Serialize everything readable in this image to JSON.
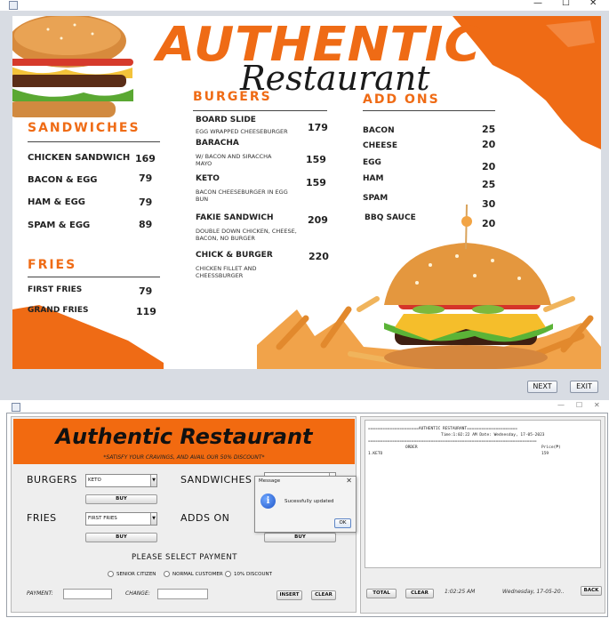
{
  "menu_window": {
    "controls": {
      "minimize": "—",
      "maximize": "☐",
      "close": "✕"
    },
    "header": {
      "title": "AUTHENTIC",
      "subtitle": "Restaurant"
    },
    "sandwiches": {
      "title": "SANDWICHES",
      "items": [
        {
          "name": "CHICKEN SANDWICH",
          "price": "169"
        },
        {
          "name": "BACON & EGG",
          "price": "79"
        },
        {
          "name": "HAM & EGG",
          "price": "79"
        },
        {
          "name": "SPAM & EGG",
          "price": "89"
        }
      ]
    },
    "fries": {
      "title": "FRIES",
      "items": [
        {
          "name": "FIRST FRIES",
          "price": "79"
        },
        {
          "name": "GRAND FRIES",
          "price": "119"
        }
      ]
    },
    "burgers": {
      "title": "BURGERS",
      "items": [
        {
          "name": "BOARD SLIDE",
          "desc": "EGG WRAPPED CHEESEBURGER",
          "price": "179"
        },
        {
          "name": "BARACHA",
          "desc": "W/ BACON AND SIRACCHA MAYO",
          "price": "159"
        },
        {
          "name": "KETO",
          "desc": "BACON CHEESEBURGER IN EGG BUN",
          "price": "159"
        },
        {
          "name": "FAKIE SANDWICH",
          "desc": "DOUBLE DOWN CHICKEN, CHEESE, BACON, NO BURGER",
          "price": "209"
        },
        {
          "name": "CHICK & BURGER",
          "desc": "CHICKEN FILLET AND CHEESSBURGER",
          "price": "220"
        }
      ]
    },
    "addons": {
      "title": "ADD ONS",
      "items": [
        {
          "name": "BACON",
          "price": "25"
        },
        {
          "name": "CHEESE",
          "price": "20"
        },
        {
          "name": "EGG",
          "price": "20"
        },
        {
          "name": "HAM",
          "price": "25"
        },
        {
          "name": "SPAM",
          "price": "30"
        },
        {
          "name": "BBQ SAUCE",
          "price": "20"
        }
      ]
    },
    "buttons": {
      "next": "NEXT",
      "exit": "EXIT"
    }
  },
  "order_window": {
    "controls": {
      "minimize": "—",
      "maximize": "☐",
      "close": "✕"
    },
    "banner": {
      "title": "Authentic Restaurant",
      "subtitle": "*SATISFY YOUR CRAVINGS, AND AVAIL OUR 50% DISCOUNT*"
    },
    "burgers": {
      "label": "BURGERS",
      "selected": "KETO",
      "buy": "BUY"
    },
    "sandwiches": {
      "label": "SANDWICHES",
      "selected": "",
      "buy": "BUY"
    },
    "fries": {
      "label": "FRIES",
      "selected": "FIRST FRIES",
      "buy": "BUY"
    },
    "addons": {
      "label": "ADDS ON",
      "selected": "",
      "buy": "BUY"
    },
    "payment": {
      "heading": "PLEASE SELECT PAYMENT",
      "options": [
        "SENIOR CITIZEN",
        "NORMAL CUSTOMER",
        "10% DISCOUNT"
      ],
      "payment_label": "PAYMENT:",
      "payment_value": "",
      "change_label": "CHANGE:",
      "change_value": "",
      "insert": "INSERT",
      "clear": "CLEAR"
    },
    "receipt": {
      "divider": "======================================================================",
      "header_line": "=====================AUTHENTIC RESTAURANT=====================",
      "time_line": "Time:1:02:22 AM   Date: Wednesday, 17-05-2023",
      "col_order": "ORDER",
      "col_price": "Price(₱)",
      "rows": [
        {
          "order": "1.KETO",
          "price": "159"
        }
      ]
    },
    "footer": {
      "total": "TOTAL",
      "clear": "CLEAR",
      "time": "1:02:25 AM",
      "date": "Wednesday, 17-05-20..",
      "back": "BACK"
    }
  },
  "dialog": {
    "title": "Message",
    "close": "✕",
    "message": "Sucessfully updated",
    "ok": "OK"
  },
  "colors": {
    "accent": "#ef6b15",
    "banner": "#f26a10",
    "info_blue": "#1f55c8"
  }
}
